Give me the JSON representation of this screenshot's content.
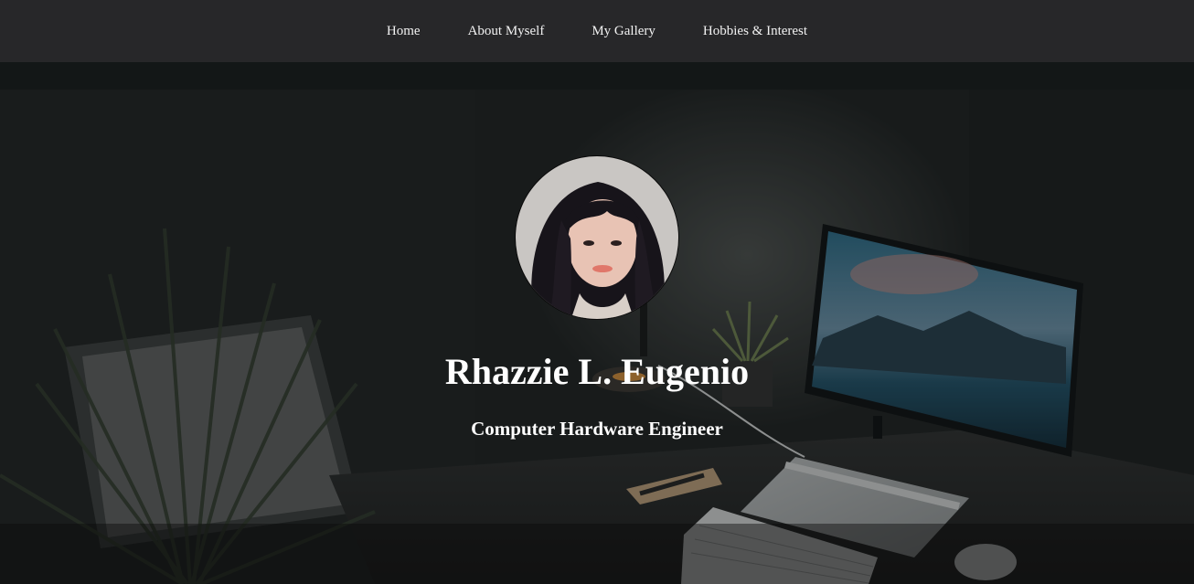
{
  "nav": {
    "items": [
      {
        "label": "Home"
      },
      {
        "label": "About Myself"
      },
      {
        "label": "My Gallery"
      },
      {
        "label": "Hobbies & Interest"
      }
    ]
  },
  "hero": {
    "name": "Rhazzie L. Eugenio",
    "role": "Computer Hardware Engineer",
    "avatar_icon": "profile-photo"
  },
  "colors": {
    "navbar_bg": "#272729",
    "nav_text": "#f2f2f2",
    "hero_text": "#ffffff",
    "scene_bg": "#1c1f1f"
  }
}
